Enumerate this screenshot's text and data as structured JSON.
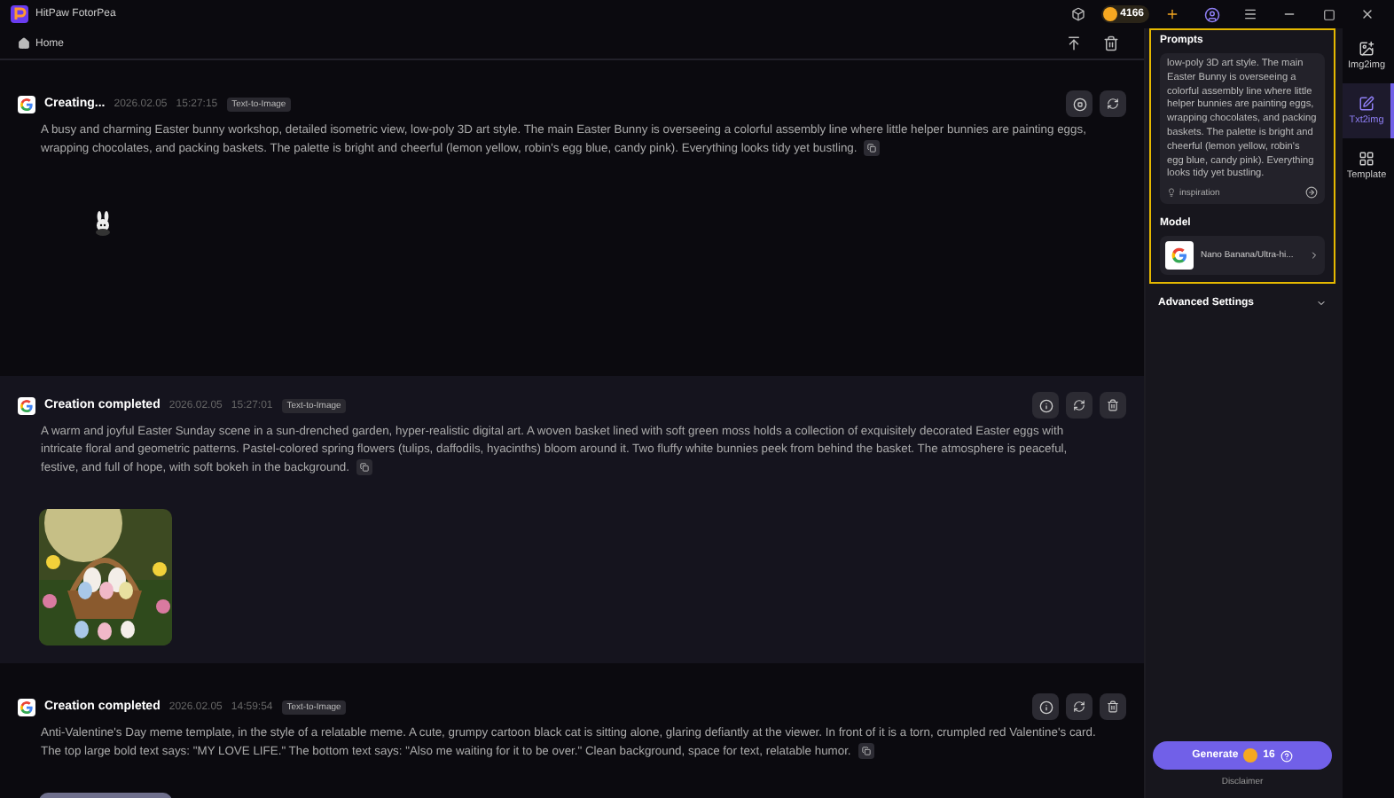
{
  "app": {
    "title": "HitPaw FotorPea",
    "credits": "4166"
  },
  "nav": {
    "home": "Home"
  },
  "feed": [
    {
      "kind": "loading",
      "status": "Creating...",
      "date": "2026.02.05",
      "time": "15:27:15",
      "tag": "Text-to-Image",
      "hovered": false,
      "prompt": "A busy and charming Easter bunny workshop, detailed isometric view, low-poly 3D art style. The main Easter Bunny is overseeing a colorful assembly line where little helper bunnies are painting eggs, wrapping chocolates, and packing baskets. The palette is bright and cheerful (lemon yellow, robin's egg blue, candy pink). Everything looks tidy yet bustling."
    },
    {
      "kind": "completed",
      "status": "Creation completed",
      "date": "2026.02.05",
      "time": "15:27:01",
      "tag": "Text-to-Image",
      "hovered": true,
      "prompt": "A warm and joyful Easter Sunday scene in a sun-drenched garden, hyper-realistic digital art. A woven basket lined with soft green moss holds a collection of exquisitely decorated Easter eggs with intricate floral and geometric patterns. Pastel-colored spring flowers (tulips, daffodils, hyacinths) bloom around it. Two fluffy white bunnies peek from behind the basket. The atmosphere is peaceful, festive, and full of hope, with soft bokeh in the background."
    },
    {
      "kind": "completed",
      "status": "Creation completed",
      "date": "2026.02.05",
      "time": "14:59:54",
      "tag": "Text-to-Image",
      "hovered": false,
      "prompt": "Anti-Valentine's Day meme template, in the style of a relatable meme. A cute, grumpy cartoon black cat is sitting alone, glaring defiantly at the viewer. In front of it is a torn, crumpled red Valentine's card. The top large bold text says: \"MY LOVE LIFE.\" The bottom text says: \"Also me waiting for it to be over.\" Clean background, space for text, relatable humor."
    }
  ],
  "panel": {
    "prompts_label": "Prompts",
    "prompt": "low-poly 3D art style. The main Easter Bunny is overseeing a colorful assembly line where little helper bunnies are painting eggs, wrapping chocolates, and packing baskets. The palette is bright and cheerful (lemon yellow, robin's egg blue, candy pink). Everything looks tidy yet bustling.",
    "inspiration": "inspiration",
    "model_label": "Model",
    "model": "Nano Banana/Ultra-hi...",
    "advanced": "Advanced Settings",
    "generate": "Generate",
    "cost": "16",
    "disclaimer": "Disclaimer"
  },
  "rail": [
    {
      "label": "Img2img",
      "selected": false
    },
    {
      "label": "Txt2img",
      "selected": true
    },
    {
      "label": "Template",
      "selected": false
    }
  ]
}
